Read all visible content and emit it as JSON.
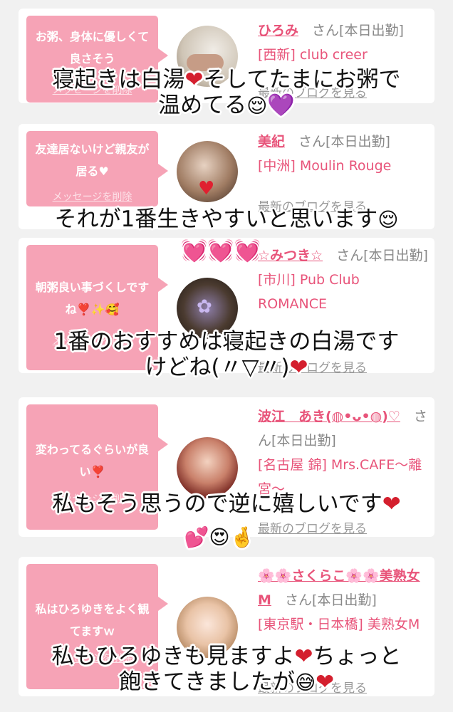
{
  "accent_color": "#e8547a",
  "bubble_color": "#f6a3b6",
  "heart_color": "#d41f2e",
  "cards": [
    {
      "message": "お粥、身体に優しくて良さそう",
      "delete_label": "メッセージを削除",
      "name": "ひろみ",
      "status": "さん[本日出勤]",
      "shop": "[西新] club creer",
      "blog_label": "最新のブログを見る"
    },
    {
      "message": "友達居ないけど親友が居る♥",
      "delete_label": "メッセージを削除",
      "name": "美紀",
      "status": "さん[本日出勤]",
      "shop": "[中洲] Moulin Rouge",
      "blog_label": "最新のブログを見る"
    },
    {
      "message": "朝粥良い事づくしですね❣️✨🥰",
      "delete_label": "メッセージを削除",
      "name": "☆みつき☆",
      "status": "さん[本日出勤]",
      "shop": "[市川] Pub Club ROMANCE",
      "blog_label": "最新のブログを見る"
    },
    {
      "message": "変わってるぐらいが良い❣️",
      "delete_label": "メッセージを削除",
      "name": "波江　あき(◍•ᴗ•◍)♡",
      "status": "さん[本日出勤]",
      "shop": "[名古屋 錦] Mrs.CAFE～離宮～",
      "blog_label": "最新のブログを見る"
    },
    {
      "message": "私はひろゆきをよく観てますｗ",
      "delete_label": "メッセージを削除",
      "name": "🌸🌸さくらこ🌸🌸美熟女M",
      "status": "さん[本日出勤]",
      "shop": "[東京駅・日本橋] 美熟女M",
      "blog_label": "最新のブログを見る"
    }
  ],
  "overlays": {
    "o1_line1": "寝起きは白湯",
    "o1_heart": "❤",
    "o1_line1b": "そしてたまにお粥で",
    "o1_line2": "温めてる",
    "o1_emoji": "😌",
    "o1_purple": "💜",
    "o2_line1": "それが1番生きやすいと思います",
    "o2_emoji": "😌",
    "o3_line1": "1番のおすすめは寝起きの白湯です",
    "o3_line2": "けどね(〃▽〃)",
    "o3_heart": "❤",
    "o4_line1": "私もそう思うので逆に嬉しいです",
    "o4_heart": "❤",
    "o4_line2": "💕😍🤞",
    "o5_line1": "私もひろゆきも見ますよ",
    "o5_heart": "❤",
    "o5_line1b": "ちょっと",
    "o5_line2": "飽きてきましたが",
    "o5_emoji": "😅",
    "o5_heart2": "❤",
    "floating_hearts": "💓💓💓"
  }
}
